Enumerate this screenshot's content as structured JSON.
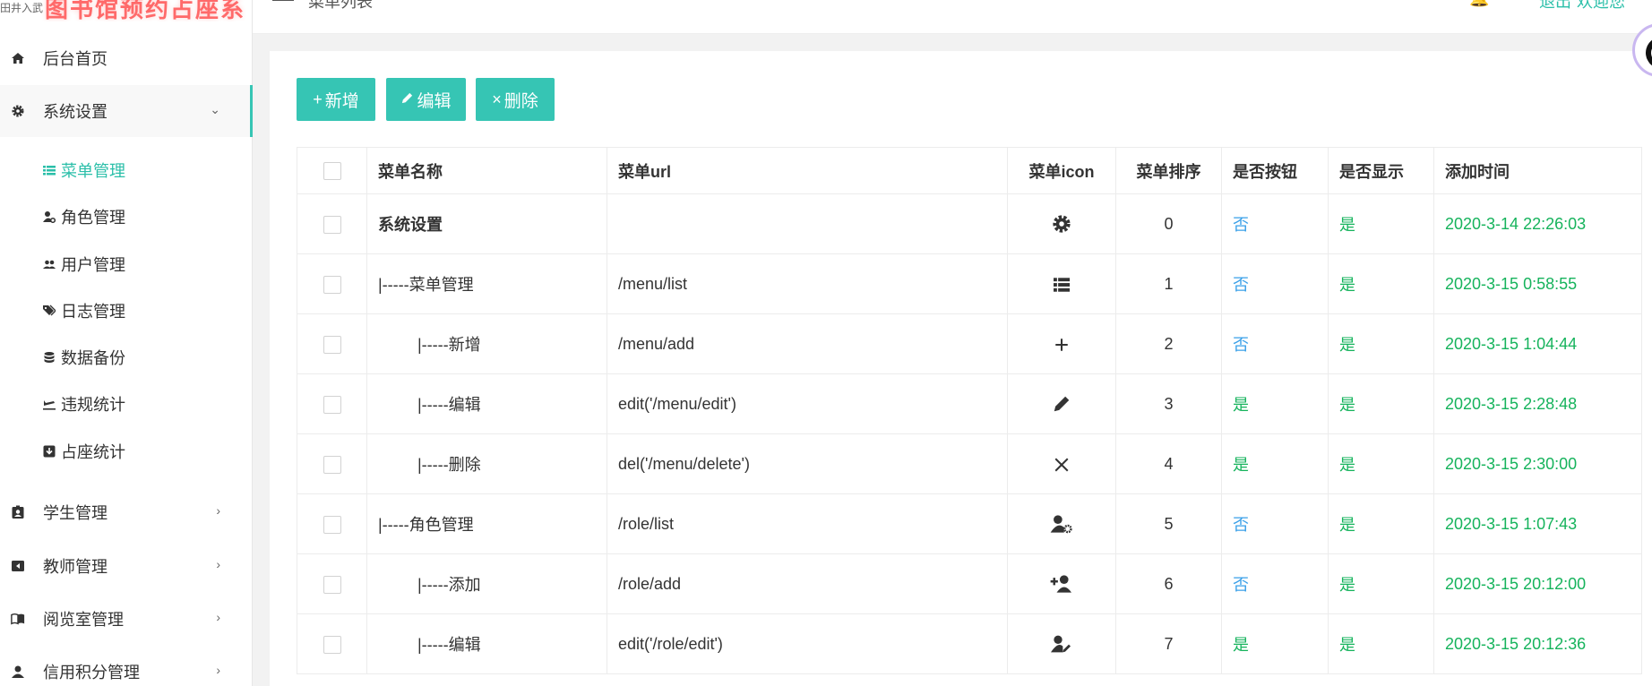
{
  "brand": {
    "mini": "田井入武",
    "title": "图书馆预约占座系统"
  },
  "topbar": {
    "breadcrumb": "菜单列表",
    "right_a": "🔔",
    "right_b": "退出",
    "right_c": "欢迎您"
  },
  "sidebar": {
    "items": [
      {
        "label": "后台首页",
        "icon": "home-icon"
      },
      {
        "label": "系统设置",
        "icon": "gear-icon",
        "expanded": true
      },
      {
        "label": "学生管理",
        "icon": "student-badge-icon"
      },
      {
        "label": "教师管理",
        "icon": "teacher-icon"
      },
      {
        "label": "阅览室管理",
        "icon": "book-open-icon"
      },
      {
        "label": "信用积分管理",
        "icon": "user-icon"
      }
    ],
    "sub_items": [
      {
        "label": "菜单管理",
        "icon": "list-icon",
        "active": true
      },
      {
        "label": "角色管理",
        "icon": "user-gear-icon"
      },
      {
        "label": "用户管理",
        "icon": "users-icon"
      },
      {
        "label": "日志管理",
        "icon": "tags-icon"
      },
      {
        "label": "数据备份",
        "icon": "database-icon"
      },
      {
        "label": "违规统计",
        "icon": "plane-icon"
      },
      {
        "label": "占座统计",
        "icon": "download-box-icon"
      }
    ]
  },
  "toolbar": {
    "add": "新增",
    "edit": "编辑",
    "delete": "删除"
  },
  "table": {
    "headers": [
      "菜单名称",
      "菜单url",
      "菜单icon",
      "菜单排序",
      "是否按钮",
      "是否显示",
      "添加时间"
    ],
    "rows": [
      {
        "name": "系统设置",
        "url": "",
        "icon": "gear-icon",
        "sort": "0",
        "is_button": "否",
        "is_show": "是",
        "time": "2020-3-14 22:26:03"
      },
      {
        "name": "|-----菜单管理",
        "url": "/menu/list",
        "icon": "list-icon",
        "sort": "1",
        "is_button": "否",
        "is_show": "是",
        "time": "2020-3-15 0:58:55"
      },
      {
        "name": "|-----新增",
        "url": "/menu/add",
        "icon": "plus-icon",
        "sort": "2",
        "is_button": "否",
        "is_show": "是",
        "time": "2020-3-15 1:04:44"
      },
      {
        "name": "|-----编辑",
        "url": "edit('/menu/edit')",
        "icon": "pencil-icon",
        "sort": "3",
        "is_button": "是",
        "is_show": "是",
        "time": "2020-3-15 2:28:48"
      },
      {
        "name": "|-----删除",
        "url": "del('/menu/delete')",
        "icon": "times-icon",
        "sort": "4",
        "is_button": "是",
        "is_show": "是",
        "time": "2020-3-15 2:30:00"
      },
      {
        "name": "|-----角色管理",
        "url": "/role/list",
        "icon": "user-gear-icon",
        "sort": "5",
        "is_button": "否",
        "is_show": "是",
        "time": "2020-3-15 1:07:43"
      },
      {
        "name": "|-----添加",
        "url": "/role/add",
        "icon": "user-plus-icon",
        "sort": "6",
        "is_button": "否",
        "is_show": "是",
        "time": "2020-3-15 20:12:00"
      },
      {
        "name": "|-----编辑",
        "url": "edit('/role/edit')",
        "icon": "user-edit-icon",
        "sort": "7",
        "is_button": "是",
        "is_show": "是",
        "time": "2020-3-15 20:12:36"
      }
    ]
  },
  "colors": {
    "accent": "#36c5b4",
    "yes": "#16b35c",
    "no": "#3aa0e8"
  }
}
